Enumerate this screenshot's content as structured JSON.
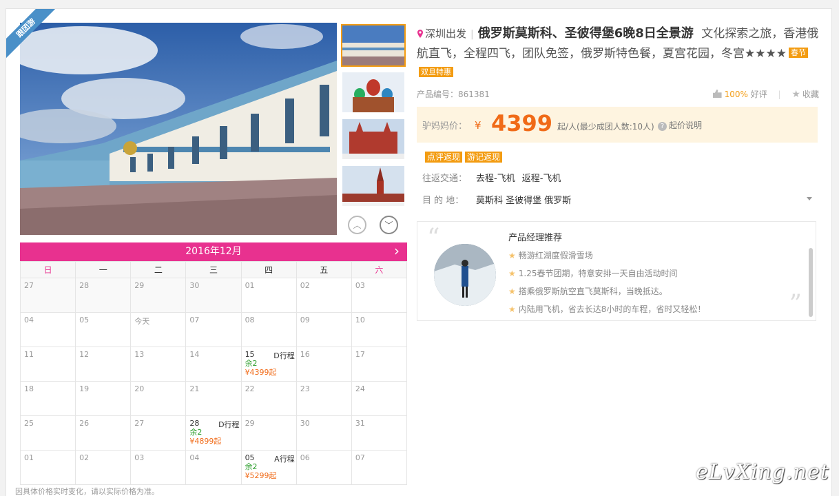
{
  "ribbon": "跟团游",
  "title": {
    "departure": "深圳出发",
    "name": "俄罗斯莫斯科、圣彼得堡6晚8日全景游",
    "subtitle": "文化探索之旅，香港俄航直飞，全程四飞，团队免签，俄罗斯特色餐，夏宫花园，冬宫★★★★",
    "tags": [
      "春节",
      "双旦特惠"
    ]
  },
  "product": {
    "code_label": "产品编号：",
    "code": "861381",
    "rating": "100%",
    "rating_label": "好评",
    "favorite": "收藏"
  },
  "price": {
    "label": "驴妈妈价：",
    "currency": "¥",
    "amount": "4399",
    "unit": "起/人(最少成团人数:10人)",
    "help": "起价说明"
  },
  "promos": [
    "点评返现",
    "游记返现"
  ],
  "transport": {
    "label": "往返交通：",
    "go": "去程-飞机",
    "back": "返程-飞机"
  },
  "destination": {
    "label": "目 的 地：",
    "value": "莫斯科 圣彼得堡 俄罗斯"
  },
  "manager": {
    "title": "产品经理推荐",
    "items": [
      "畅游红湖度假滑雪场",
      "1.25春节团期，特意安排一天自由活动时间",
      "搭乘俄罗斯航空直飞莫斯科，当晚抵达。",
      "内陆用飞机，省去长达8小时的车程，省时又轻松！"
    ]
  },
  "calendar": {
    "month": "2016年12月",
    "weekdays": [
      "日",
      "一",
      "二",
      "三",
      "四",
      "五",
      "六"
    ],
    "rows": [
      [
        {
          "d": "27"
        },
        {
          "d": "28"
        },
        {
          "d": "29"
        },
        {
          "d": "30"
        },
        {
          "d": "01"
        },
        {
          "d": "02"
        },
        {
          "d": "03"
        }
      ],
      [
        {
          "d": "04"
        },
        {
          "d": "05"
        },
        {
          "d": "今天"
        },
        {
          "d": "07"
        },
        {
          "d": "08"
        },
        {
          "d": "09"
        },
        {
          "d": "10"
        }
      ],
      [
        {
          "d": "11"
        },
        {
          "d": "12"
        },
        {
          "d": "13"
        },
        {
          "d": "14"
        },
        {
          "d": "15",
          "line": "D行程",
          "rem": "余2",
          "price": "¥4399起"
        },
        {
          "d": "16"
        },
        {
          "d": "17"
        }
      ],
      [
        {
          "d": "18"
        },
        {
          "d": "19"
        },
        {
          "d": "20"
        },
        {
          "d": "21"
        },
        {
          "d": "22"
        },
        {
          "d": "23"
        },
        {
          "d": "24"
        }
      ],
      [
        {
          "d": "25"
        },
        {
          "d": "26"
        },
        {
          "d": "27"
        },
        {
          "d": "28",
          "line": "D行程",
          "rem": "余2",
          "price": "¥4899起"
        },
        {
          "d": "29"
        },
        {
          "d": "30"
        },
        {
          "d": "31"
        }
      ],
      [
        {
          "d": "01"
        },
        {
          "d": "02"
        },
        {
          "d": "03"
        },
        {
          "d": "04"
        },
        {
          "d": "05",
          "line": "A行程",
          "rem": "余2",
          "price": "¥5299起"
        },
        {
          "d": "06"
        },
        {
          "d": "07"
        }
      ]
    ],
    "note": "因具体价格实时变化，请以实际价格为准。"
  },
  "watermark": "eLvXing.net",
  "colors": {
    "accent": "#e8318f",
    "price": "#f06a17",
    "tag": "#f39c12",
    "ribbon": "#4a90c8"
  }
}
